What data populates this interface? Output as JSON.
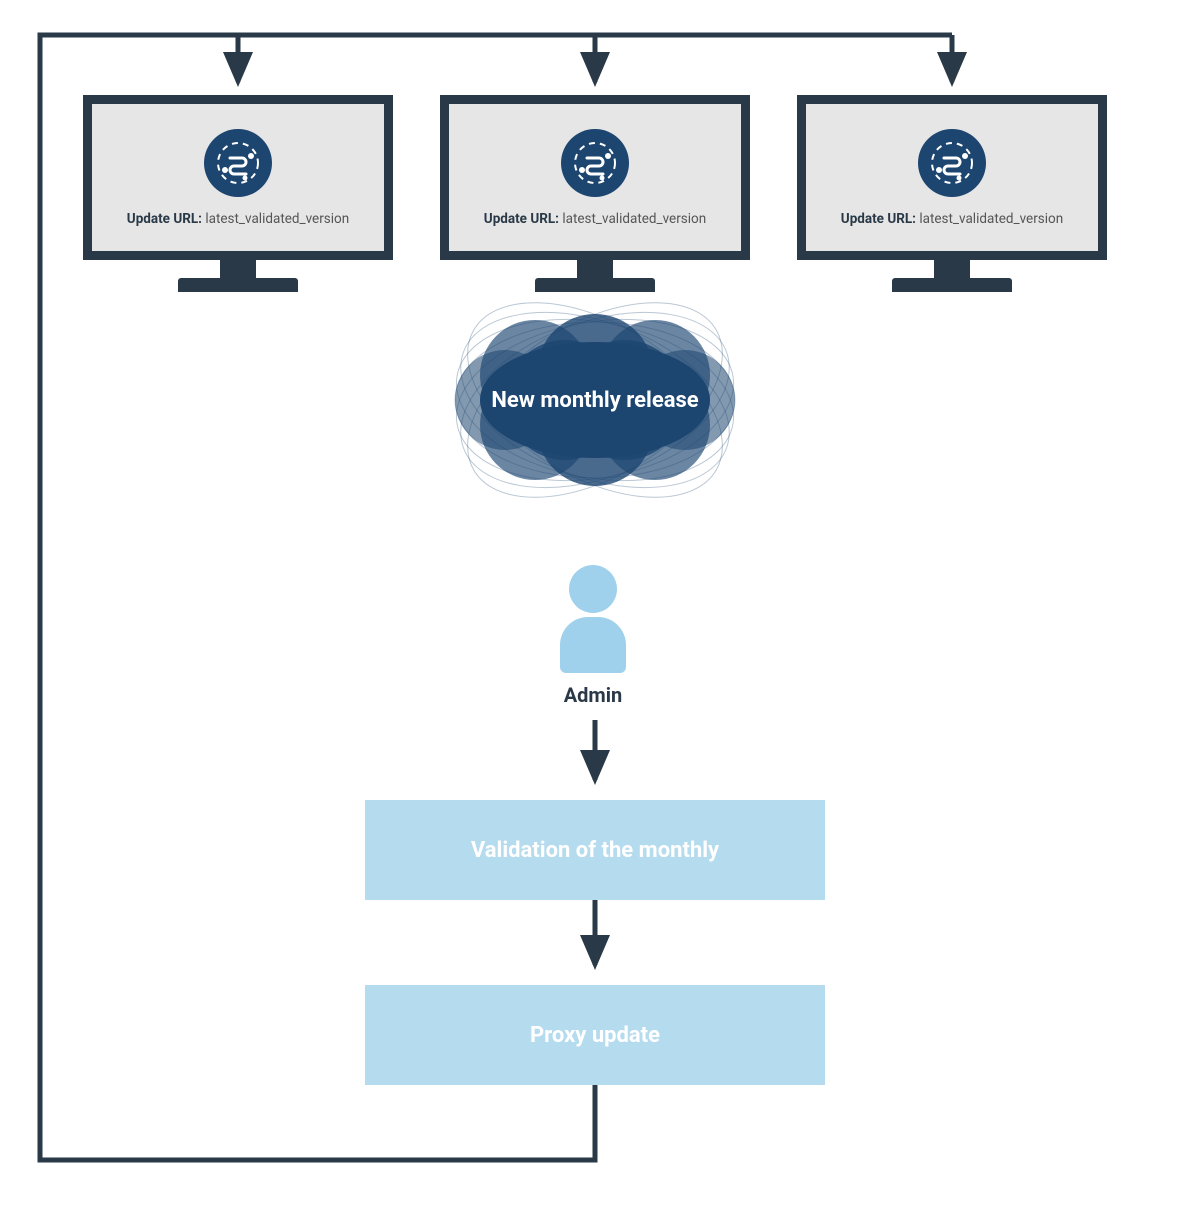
{
  "monitors": [
    {
      "url_label": "Update URL:",
      "url_value": "latest_validated_version"
    },
    {
      "url_label": "Update URL:",
      "url_value": "latest_validated_version"
    },
    {
      "url_label": "Update URL:",
      "url_value": "latest_validated_version"
    }
  ],
  "cloud": {
    "label": "New monthly release"
  },
  "admin": {
    "label": "Admin"
  },
  "steps": {
    "validation": "Validation of the monthly",
    "proxy": "Proxy update"
  },
  "colors": {
    "dark": "#2a3947",
    "navy": "#1c4570",
    "lightblue": "#b5dbef",
    "iconblue": "#9fd1ec"
  }
}
